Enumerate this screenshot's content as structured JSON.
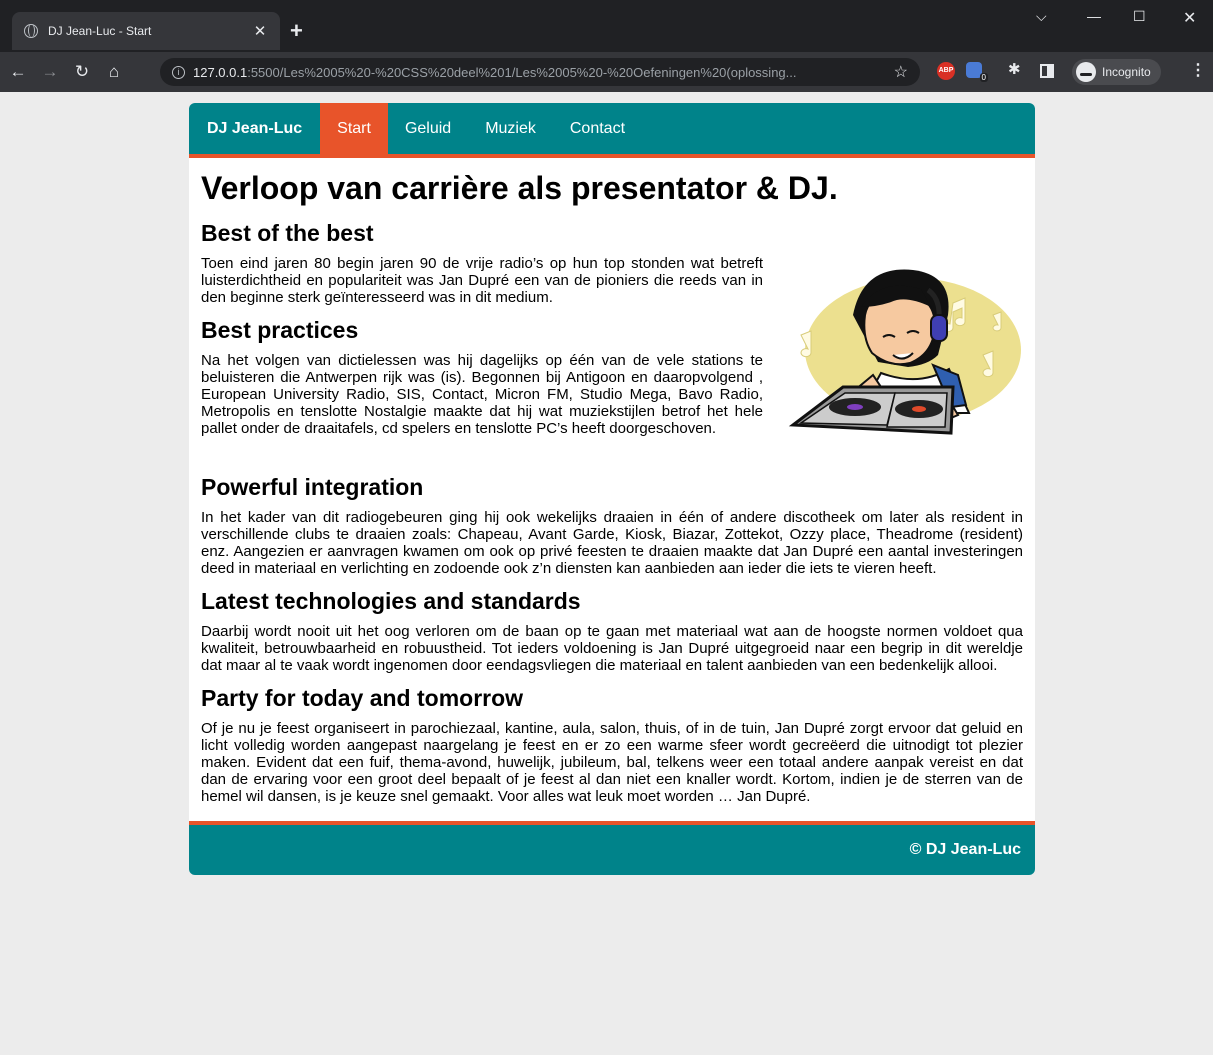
{
  "browser": {
    "tab_title": "DJ Jean-Luc - Start",
    "url_host": "127.0.0.1",
    "url_path": ":5500/Les%2005%20-%20CSS%20deel%201/Les%2005%20-%20Oefeningen%20(oplossing...",
    "incognito_label": "Incognito",
    "ext_badge": "0",
    "abp_label": "ABP"
  },
  "nav": {
    "brand": "DJ Jean-Luc",
    "items": [
      {
        "label": "Start",
        "active": true
      },
      {
        "label": "Geluid",
        "active": false
      },
      {
        "label": "Muziek",
        "active": false
      },
      {
        "label": "Contact",
        "active": false
      }
    ]
  },
  "page": {
    "title": "Verloop van carrière als presentator & DJ.",
    "sections": [
      {
        "heading": "Best of the best",
        "text": "Toen eind jaren 80 begin jaren 90 de vrije radio’s op hun top stonden wat betreft luisterdichtheid en populariteit was Jan Dupré een van de pioniers die reeds van in den beginne sterk geïnteresseerd was in dit medium."
      },
      {
        "heading": "Best practices",
        "text": "Na het volgen van dictielessen was hij dagelijks op één van de vele stations te beluisteren die Antwerpen rijk was (is). Begonnen bij Antigoon en daaropvolgend , European University Radio, SIS, Contact, Micron FM, Studio Mega, Bavo Radio, Metropolis en tenslotte Nostalgie maakte dat hij wat muziekstijlen betrof het hele pallet onder de draaitafels, cd spelers en tenslotte PC’s heeft doorgeschoven."
      },
      {
        "heading": "Powerful integration",
        "text": "In het kader van dit radiogebeuren ging hij ook wekelijks draaien in één of andere discotheek om later als resident in verschillende clubs te draaien zoals: Chapeau, Avant Garde, Kiosk, Biazar, Zottekot, Ozzy place, Theadrome (resident) enz. Aangezien er aanvragen kwamen om ook op privé feesten te draaien maakte dat Jan Dupré een aantal investeringen deed in materiaal en verlichting en zodoende ook z’n diensten kan aanbieden aan ieder die iets te vieren heeft."
      },
      {
        "heading": "Latest technologies and standards",
        "text": "Daarbij wordt nooit uit het oog verloren om de baan op te gaan met materiaal wat aan de hoogste normen voldoet qua kwaliteit, betrouwbaarheid en robuustheid. Tot ieders voldoening is Jan Dupré uitgegroeid naar een begrip in dit wereldje dat maar al te vaak wordt ingenomen door eendagsvliegen die materiaal en talent aanbieden van een bedenkelijk allooi."
      },
      {
        "heading": "Party for today and tomorrow",
        "text": "Of je nu je feest organiseert in parochiezaal, kantine, aula, salon, thuis, of in de tuin, Jan Dupré zorgt ervoor dat geluid en licht volledig worden aangepast naargelang je feest en er zo een warme sfeer wordt gecreëerd die uitnodigt tot plezier maken. Evident dat een fuif, thema-avond, huwelijk, jubileum, bal, telkens weer een totaal andere aanpak vereist en dat dan de ervaring voor een groot deel bepaalt of je feest al dan niet een knaller wordt. Kortom, indien je de sterren van de hemel wil dansen, is je keuze snel gemaakt. Voor alles wat leuk moet worden … Jan Dupré."
      }
    ]
  },
  "footer": {
    "text": "© DJ Jean-Luc"
  },
  "colors": {
    "teal": "#00838a",
    "accent": "#e8542a"
  }
}
